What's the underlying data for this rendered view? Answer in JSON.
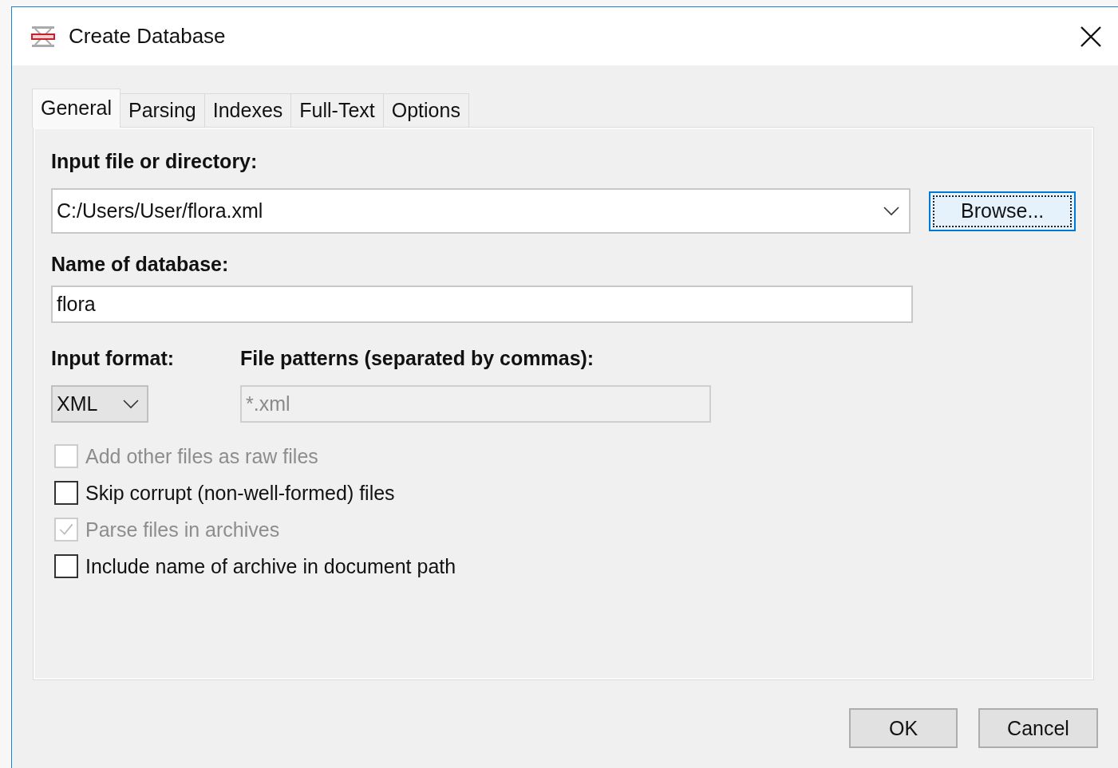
{
  "window": {
    "title": "Create Database"
  },
  "tabs": [
    {
      "label": "General",
      "selected": true
    },
    {
      "label": "Parsing",
      "selected": false
    },
    {
      "label": "Indexes",
      "selected": false
    },
    {
      "label": "Full-Text",
      "selected": false
    },
    {
      "label": "Options",
      "selected": false
    }
  ],
  "input_file": {
    "label": "Input file or directory:",
    "value": "C:/Users/User/flora.xml",
    "browse": {
      "label": "Browse...",
      "focused": true
    }
  },
  "database_name": {
    "label": "Name of database:",
    "value": "flora"
  },
  "input_format": {
    "label": "Input format:",
    "value": "XML"
  },
  "file_patterns": {
    "label": "File patterns (separated by commas):",
    "value": "*.xml",
    "disabled": true
  },
  "options": [
    {
      "label": "Add other files as raw files",
      "checked": false,
      "disabled": true
    },
    {
      "label": "Skip corrupt (non-well-formed) files",
      "checked": false,
      "disabled": false
    },
    {
      "label": "Parse files in archives",
      "checked": true,
      "disabled": true
    },
    {
      "label": "Include name of archive in document path",
      "checked": false,
      "disabled": false
    }
  ],
  "buttons": [
    {
      "label": "OK"
    },
    {
      "label": "Cancel"
    }
  ]
}
